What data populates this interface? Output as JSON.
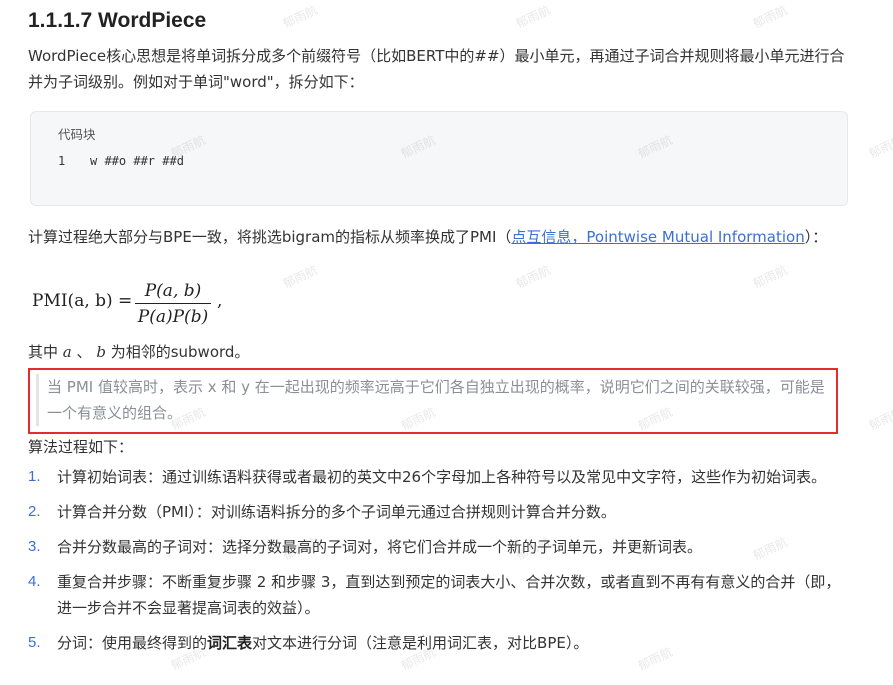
{
  "heading": "1.1.1.7 WordPiece",
  "intro": "WordPiece核心思想是将单词拆分成多个前缀符号（比如BERT中的##）最小单元，再通过子词合并规则将最小单元进行合并为子词级别。例如对于单词\"word\"，拆分如下：",
  "code": {
    "label": "代码块",
    "line_number": "1",
    "line_text": "w ##o ##r ##d"
  },
  "calc": {
    "before": "计算过程绝大部分与BPE一致，将挑选bigram的指标从频率换成了PMI（",
    "link": "点互信息，Pointwise Mutual Information",
    "after": "）："
  },
  "formula": {
    "lhs": "PMI(a, b) =",
    "numerator": "P(a, b)",
    "denominator": "P(a)P(b)",
    "trailing": ","
  },
  "where": {
    "prefix": "其中",
    "var_a": "a",
    "sep": "、",
    "var_b": "b",
    "suffix": "为相邻的subword。"
  },
  "note": "当 PMI 值较高时，表示 x 和 y 在一起出现的频率远高于它们各自独立出现的概率，说明它们之间的关联较强，可能是一个有意义的组合。",
  "algo_title": "算法过程如下：",
  "steps": [
    {
      "num": "1.",
      "text": "计算初始词表：通过训练语料获得或者最初的英文中26个字母加上各种符号以及常见中文字符，这些作为初始词表。"
    },
    {
      "num": "2.",
      "text": "计算合并分数（PMI）：对训练语料拆分的多个子词单元通过合拼规则计算合并分数。"
    },
    {
      "num": "3.",
      "text": "合并分数最高的子词对：选择分数最高的子词对，将它们合并成一个新的子词单元，并更新词表。"
    },
    {
      "num": "4.",
      "text": "重复合并步骤：不断重复步骤 2 和步骤 3，直到达到预定的词表大小、合并次数，或者直到不再有有意义的合并（即，进一步合并不会显著提高词表的效益）。"
    },
    {
      "num": "5.",
      "before": "分词：使用最终得到的",
      "bold": "词汇表",
      "after": "对文本进行分词（注意是利用词汇表，对比BPE）。"
    }
  ],
  "watermark": "郁雨航"
}
